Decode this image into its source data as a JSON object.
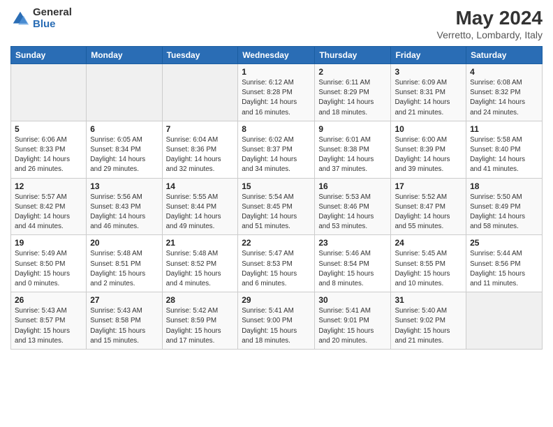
{
  "logo": {
    "general": "General",
    "blue": "Blue"
  },
  "title": "May 2024",
  "location": "Verretto, Lombardy, Italy",
  "days_of_week": [
    "Sunday",
    "Monday",
    "Tuesday",
    "Wednesday",
    "Thursday",
    "Friday",
    "Saturday"
  ],
  "weeks": [
    [
      {
        "day": "",
        "info": ""
      },
      {
        "day": "",
        "info": ""
      },
      {
        "day": "",
        "info": ""
      },
      {
        "day": "1",
        "info": "Sunrise: 6:12 AM\nSunset: 8:28 PM\nDaylight: 14 hours\nand 16 minutes."
      },
      {
        "day": "2",
        "info": "Sunrise: 6:11 AM\nSunset: 8:29 PM\nDaylight: 14 hours\nand 18 minutes."
      },
      {
        "day": "3",
        "info": "Sunrise: 6:09 AM\nSunset: 8:31 PM\nDaylight: 14 hours\nand 21 minutes."
      },
      {
        "day": "4",
        "info": "Sunrise: 6:08 AM\nSunset: 8:32 PM\nDaylight: 14 hours\nand 24 minutes."
      }
    ],
    [
      {
        "day": "5",
        "info": "Sunrise: 6:06 AM\nSunset: 8:33 PM\nDaylight: 14 hours\nand 26 minutes."
      },
      {
        "day": "6",
        "info": "Sunrise: 6:05 AM\nSunset: 8:34 PM\nDaylight: 14 hours\nand 29 minutes."
      },
      {
        "day": "7",
        "info": "Sunrise: 6:04 AM\nSunset: 8:36 PM\nDaylight: 14 hours\nand 32 minutes."
      },
      {
        "day": "8",
        "info": "Sunrise: 6:02 AM\nSunset: 8:37 PM\nDaylight: 14 hours\nand 34 minutes."
      },
      {
        "day": "9",
        "info": "Sunrise: 6:01 AM\nSunset: 8:38 PM\nDaylight: 14 hours\nand 37 minutes."
      },
      {
        "day": "10",
        "info": "Sunrise: 6:00 AM\nSunset: 8:39 PM\nDaylight: 14 hours\nand 39 minutes."
      },
      {
        "day": "11",
        "info": "Sunrise: 5:58 AM\nSunset: 8:40 PM\nDaylight: 14 hours\nand 41 minutes."
      }
    ],
    [
      {
        "day": "12",
        "info": "Sunrise: 5:57 AM\nSunset: 8:42 PM\nDaylight: 14 hours\nand 44 minutes."
      },
      {
        "day": "13",
        "info": "Sunrise: 5:56 AM\nSunset: 8:43 PM\nDaylight: 14 hours\nand 46 minutes."
      },
      {
        "day": "14",
        "info": "Sunrise: 5:55 AM\nSunset: 8:44 PM\nDaylight: 14 hours\nand 49 minutes."
      },
      {
        "day": "15",
        "info": "Sunrise: 5:54 AM\nSunset: 8:45 PM\nDaylight: 14 hours\nand 51 minutes."
      },
      {
        "day": "16",
        "info": "Sunrise: 5:53 AM\nSunset: 8:46 PM\nDaylight: 14 hours\nand 53 minutes."
      },
      {
        "day": "17",
        "info": "Sunrise: 5:52 AM\nSunset: 8:47 PM\nDaylight: 14 hours\nand 55 minutes."
      },
      {
        "day": "18",
        "info": "Sunrise: 5:50 AM\nSunset: 8:49 PM\nDaylight: 14 hours\nand 58 minutes."
      }
    ],
    [
      {
        "day": "19",
        "info": "Sunrise: 5:49 AM\nSunset: 8:50 PM\nDaylight: 15 hours\nand 0 minutes."
      },
      {
        "day": "20",
        "info": "Sunrise: 5:48 AM\nSunset: 8:51 PM\nDaylight: 15 hours\nand 2 minutes."
      },
      {
        "day": "21",
        "info": "Sunrise: 5:48 AM\nSunset: 8:52 PM\nDaylight: 15 hours\nand 4 minutes."
      },
      {
        "day": "22",
        "info": "Sunrise: 5:47 AM\nSunset: 8:53 PM\nDaylight: 15 hours\nand 6 minutes."
      },
      {
        "day": "23",
        "info": "Sunrise: 5:46 AM\nSunset: 8:54 PM\nDaylight: 15 hours\nand 8 minutes."
      },
      {
        "day": "24",
        "info": "Sunrise: 5:45 AM\nSunset: 8:55 PM\nDaylight: 15 hours\nand 10 minutes."
      },
      {
        "day": "25",
        "info": "Sunrise: 5:44 AM\nSunset: 8:56 PM\nDaylight: 15 hours\nand 11 minutes."
      }
    ],
    [
      {
        "day": "26",
        "info": "Sunrise: 5:43 AM\nSunset: 8:57 PM\nDaylight: 15 hours\nand 13 minutes."
      },
      {
        "day": "27",
        "info": "Sunrise: 5:43 AM\nSunset: 8:58 PM\nDaylight: 15 hours\nand 15 minutes."
      },
      {
        "day": "28",
        "info": "Sunrise: 5:42 AM\nSunset: 8:59 PM\nDaylight: 15 hours\nand 17 minutes."
      },
      {
        "day": "29",
        "info": "Sunrise: 5:41 AM\nSunset: 9:00 PM\nDaylight: 15 hours\nand 18 minutes."
      },
      {
        "day": "30",
        "info": "Sunrise: 5:41 AM\nSunset: 9:01 PM\nDaylight: 15 hours\nand 20 minutes."
      },
      {
        "day": "31",
        "info": "Sunrise: 5:40 AM\nSunset: 9:02 PM\nDaylight: 15 hours\nand 21 minutes."
      },
      {
        "day": "",
        "info": ""
      }
    ]
  ]
}
